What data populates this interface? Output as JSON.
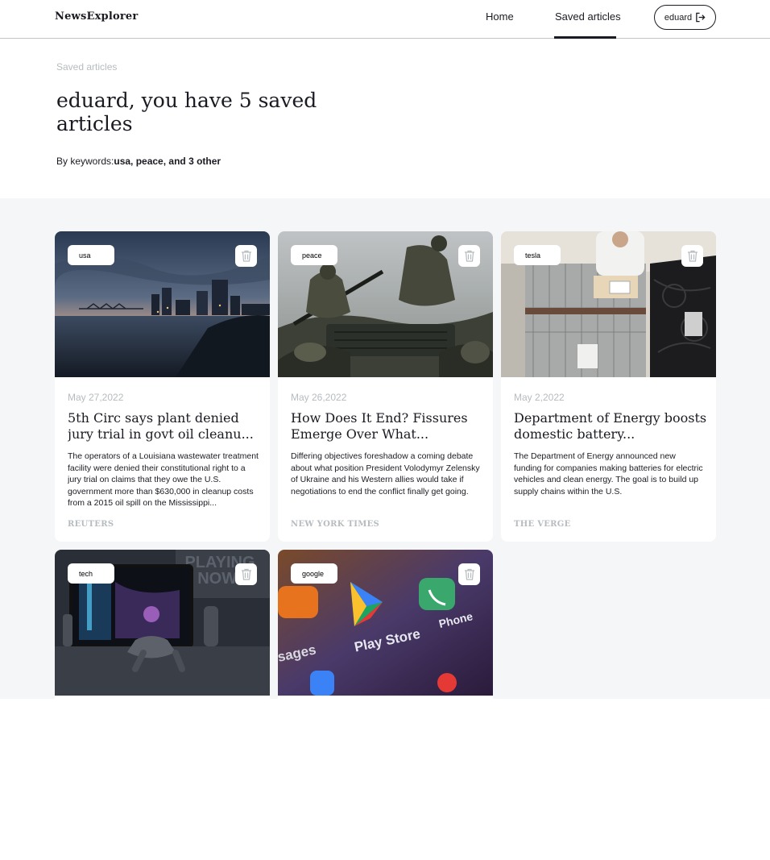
{
  "header": {
    "logo": "NewsExplorer",
    "nav_home": "Home",
    "nav_saved": "Saved articles",
    "user_name": "eduard",
    "logout_icon": "logout-icon"
  },
  "intro": {
    "label": "Saved articles",
    "title": "eduard, you have 5 saved articles",
    "keywords_prefix": "By keywords:",
    "keywords_value": "usa, peace, and 3 other"
  },
  "cards": [
    {
      "keyword": "usa",
      "date": "May 27,2022",
      "title": "5th Circ says plant denied jury trial in govt oil cleanu...",
      "text": "The operators of a Louisiana wastewater treatment facility were denied their constitutional right to a jury trial on claims that they owe the U.S. government more than $630,000 in cleanup costs from a 2015 oil spill on the Mississippi...",
      "source": "REUTERS"
    },
    {
      "keyword": "peace",
      "date": "May 26,2022",
      "title": "How Does It End? Fissures Emerge Over What...",
      "text": "Differing objectives foreshadow a coming debate about what position President Volodymyr Zelensky of Ukraine and his Western allies would take if negotiations to end the conflict finally get going.",
      "source": "NEW YORK TIMES"
    },
    {
      "keyword": "tesla",
      "date": "May 2,2022",
      "title": "Department of Energy boosts domestic battery...",
      "text": "The Department of Energy announced new funding for companies making batteries for electric vehicles and clean energy. The goal is to build up supply chains within the U.S.",
      "source": "THE VERGE"
    },
    {
      "keyword": "tech",
      "date": "",
      "title": "",
      "text": "",
      "source": ""
    },
    {
      "keyword": "google",
      "date": "",
      "title": "",
      "text": "",
      "source": ""
    }
  ],
  "image_text": {
    "tech_poster": "PLAYING NOW!",
    "google_play": "Play Store",
    "google_phone": "Phone",
    "google_messages": "ssages"
  },
  "colors": {
    "text": "#1a1b22",
    "muted": "#b6bcbf",
    "background": "#f5f6f7"
  }
}
